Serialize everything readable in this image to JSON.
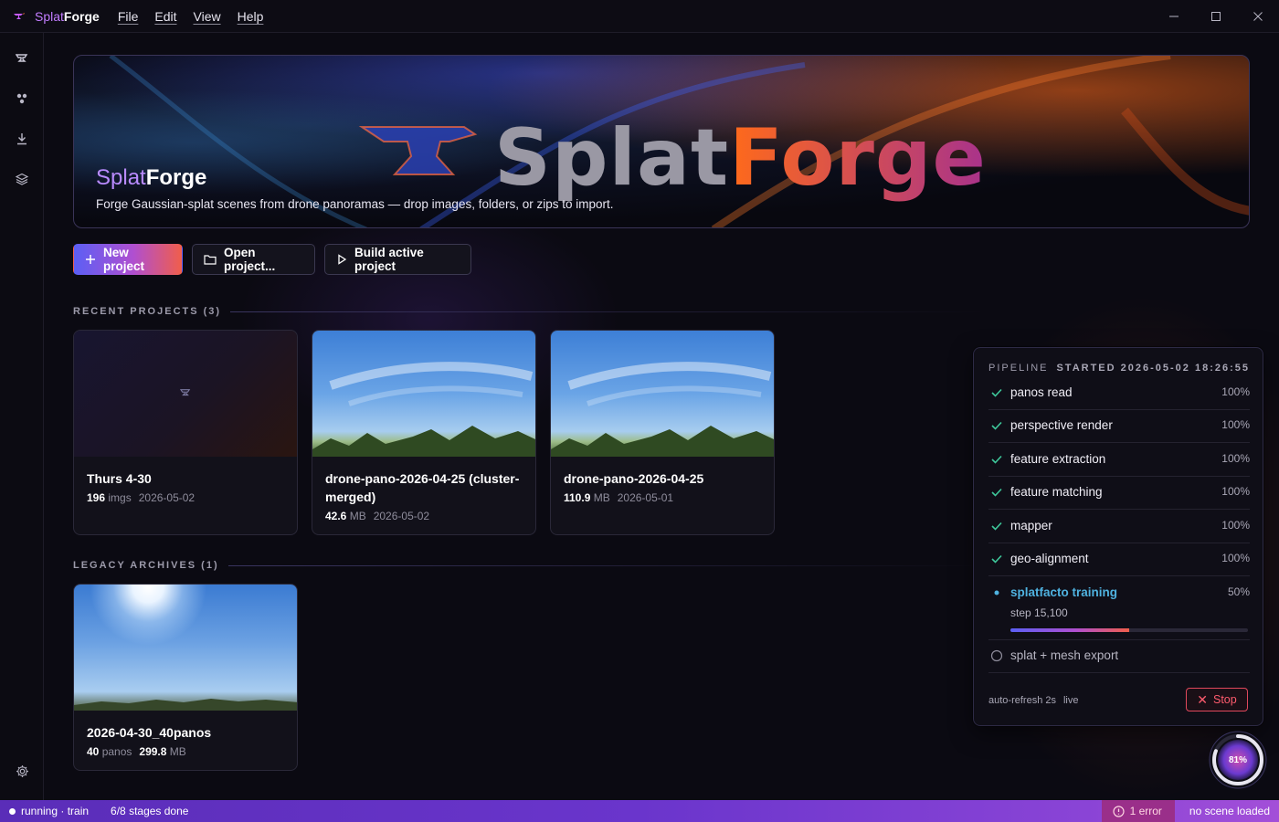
{
  "titlebar": {
    "app_name_part1": "Splat",
    "app_name_part2": "Forge",
    "menu": [
      "File",
      "Edit",
      "View",
      "Help"
    ]
  },
  "hero": {
    "title_part1": "Splat",
    "title_part2": "Forge",
    "subtitle": "Forge Gaussian-splat scenes from drone panoramas — drop images, folders, or zips to import.",
    "wordmark_part1": "Splat",
    "wordmark_part2": "Forge"
  },
  "actions": {
    "new_project": "New project",
    "open_project": "Open project...",
    "build_active": "Build active project"
  },
  "recent": {
    "header": "RECENT PROJECTS (3)",
    "cards": [
      {
        "name": "Thurs 4-30",
        "count": "196",
        "count_unit": "imgs",
        "date": "2026-05-02"
      },
      {
        "name": "drone-pano-2026-04-25 (cluster-merged)",
        "size": "42.6",
        "size_unit": "MB",
        "date": "2026-05-02"
      },
      {
        "name": "drone-pano-2026-04-25",
        "size": "110.9",
        "size_unit": "MB",
        "date": "2026-05-01"
      }
    ]
  },
  "legacy": {
    "header": "LEGACY ARCHIVES (1)",
    "cards": [
      {
        "name": "2026-04-30_40panos",
        "count": "40",
        "count_unit": "panos",
        "size": "299.8",
        "size_unit": "MB"
      }
    ]
  },
  "pipeline": {
    "title": "PIPELINE",
    "started": "STARTED 2026-05-02 18:26:55",
    "stages": [
      {
        "label": "panos read",
        "pct": "100%",
        "status": "done"
      },
      {
        "label": "perspective render",
        "pct": "100%",
        "status": "done"
      },
      {
        "label": "feature extraction",
        "pct": "100%",
        "status": "done"
      },
      {
        "label": "feature matching",
        "pct": "100%",
        "status": "done"
      },
      {
        "label": "mapper",
        "pct": "100%",
        "status": "done"
      },
      {
        "label": "geo-alignment",
        "pct": "100%",
        "status": "done"
      },
      {
        "label": "splatfacto training",
        "pct": "50%",
        "status": "active",
        "sub": "step 15,100",
        "progress": 0.5
      },
      {
        "label": "splat + mesh export",
        "pct": "",
        "status": "pending"
      }
    ],
    "footer_refresh": "auto-refresh 2s",
    "footer_live": "live",
    "stop_label": "Stop"
  },
  "ring": {
    "label": "81%",
    "progress": 0.81
  },
  "statusbar": {
    "state": "running · train",
    "stages": "6/8 stages done",
    "errors": "1 error",
    "scene": "no scene loaded"
  },
  "colors": {
    "accent_gradient": [
      "#5b5ff5",
      "#b04fd0",
      "#f05e4b"
    ],
    "active_stage": "#4fb2e0",
    "stop": "#e0485c",
    "status_bar": "#6a35cc"
  }
}
